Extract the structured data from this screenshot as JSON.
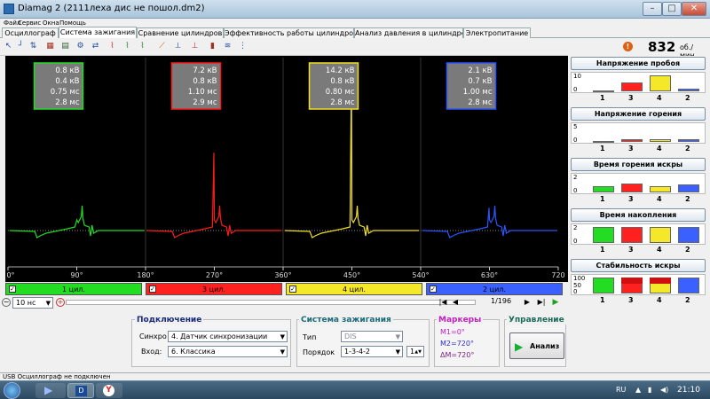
{
  "window": {
    "title": "Diamag 2 (2111леха дис не пошол.dm2)",
    "controls": [
      "–",
      "□",
      "✕"
    ]
  },
  "menu": [
    "Файл",
    "Сервис",
    "Окна",
    "Помощь"
  ],
  "tabs": [
    {
      "label": "Осциллограф",
      "active": false
    },
    {
      "label": "Система зажигания",
      "active": true
    },
    {
      "label": "Сравнение цилиндров",
      "active": false
    },
    {
      "label": "Эффективность работы цилиндров",
      "active": false
    },
    {
      "label": "Анализ давления в цилиндре",
      "active": false
    },
    {
      "label": "Электропитание",
      "active": false
    }
  ],
  "toolbar_icons": [
    "cursor-icon",
    "markers-icon",
    "zoom-icon",
    "grid-icon",
    "table-icon",
    "settings-icon",
    "export-icon",
    "wave-icon",
    "wave2-icon",
    "wave3-icon",
    "wave4-icon",
    "single-shot-icon",
    "marker-icon",
    "histogram-icon",
    "bars-icon",
    "filter-icon"
  ],
  "rpm": {
    "value": "832",
    "unit": "об./мин."
  },
  "chart_data": {
    "type": "line",
    "x_ticks": [
      "0°",
      "90°",
      "180°",
      "270°",
      "360°",
      "450°",
      "540°",
      "630°",
      "720"
    ],
    "xlim": [
      0,
      720
    ],
    "series": [
      {
        "name": "1 цил.",
        "color": "#22dd22",
        "span": [
          0,
          180
        ],
        "spark_at": 90,
        "peak_kv": 0.8
      },
      {
        "name": "3 цил.",
        "color": "#ff1a1a",
        "span": [
          180,
          360
        ],
        "spark_at": 270,
        "peak_kv": 7.2
      },
      {
        "name": "4 цил.",
        "color": "#f0e020",
        "span": [
          360,
          540
        ],
        "spark_at": 450,
        "peak_kv": 14.2
      },
      {
        "name": "2 цил.",
        "color": "#2a55ff",
        "span": [
          540,
          720
        ],
        "spark_at": 630,
        "peak_kv": 2.1
      }
    ],
    "readouts": [
      {
        "cyl": 1,
        "lines": [
          "0.8 кВ",
          "0.4 кВ",
          "0.75 мс",
          "2.8 мс"
        ]
      },
      {
        "cyl": 3,
        "lines": [
          "7.2 кВ",
          "0.8 кВ",
          "1.10 мс",
          "2.9 мс"
        ]
      },
      {
        "cyl": 4,
        "lines": [
          "14.2 кВ",
          "0.8 кВ",
          "0.80 мс",
          "2.8 мс"
        ]
      },
      {
        "cyl": 2,
        "lines": [
          "2.1 кВ",
          "0.7 кВ",
          "1.00 мс",
          "2.8 мс"
        ]
      }
    ]
  },
  "cylinders": [
    {
      "label": "1 цил.",
      "color": "#22dd22",
      "checked": true
    },
    {
      "label": "3 цил.",
      "color": "#ff2020",
      "checked": true
    },
    {
      "label": "4 цил.",
      "color": "#f5e828",
      "checked": true
    },
    {
      "label": "2 цил.",
      "color": "#3a60ff",
      "checked": true
    }
  ],
  "nav": {
    "timebase": "10 нс",
    "frame": "1/196"
  },
  "connection": {
    "title": "Подключение",
    "sync_label": "Синхро",
    "sync_value": "4. Датчик синхронизации",
    "input_label": "Вход:",
    "input_value": "6. Классика"
  },
  "ignition": {
    "title": "Система зажигания",
    "type_label": "Тип",
    "type_value": "DIS",
    "order_label": "Порядок",
    "order_value": "1-3-4-2",
    "order_num": "1"
  },
  "markers": {
    "title": "Маркеры",
    "m1": "M1=0°",
    "m2": "M2=720°",
    "dm": "ΔM=720°"
  },
  "control": {
    "title": "Управление",
    "analyze": "Анализ"
  },
  "panels": [
    {
      "title": "Напряжение пробоя",
      "yticks": [
        "10",
        "0"
      ],
      "levels": [
        0.06,
        0.55,
        1.0,
        0.15
      ]
    },
    {
      "title": "Напряжение горения",
      "yticks": [
        "5",
        "0"
      ],
      "levels": [
        0.08,
        0.16,
        0.16,
        0.14
      ]
    },
    {
      "title": "Время горения искры",
      "yticks": [
        "2",
        "0"
      ],
      "levels": [
        0.38,
        0.55,
        0.4,
        0.5
      ]
    },
    {
      "title": "Время накопления",
      "yticks": [
        "2",
        "0"
      ],
      "levels": [
        1.0,
        1.0,
        1.0,
        1.0
      ]
    },
    {
      "title": "Стабильность искры",
      "yticks": [
        "100",
        "50",
        "0"
      ],
      "levels": [
        1.0,
        1.0,
        1.0,
        1.0
      ]
    }
  ],
  "bar_labels": [
    "1",
    "3",
    "4",
    "2"
  ],
  "bar_colors": [
    "#22dd22",
    "#ff2020",
    "#f5e828",
    "#3a60ff"
  ],
  "status": "USB Осциллограф не подключен",
  "tray": {
    "lang": "RU",
    "time": "21:10"
  }
}
